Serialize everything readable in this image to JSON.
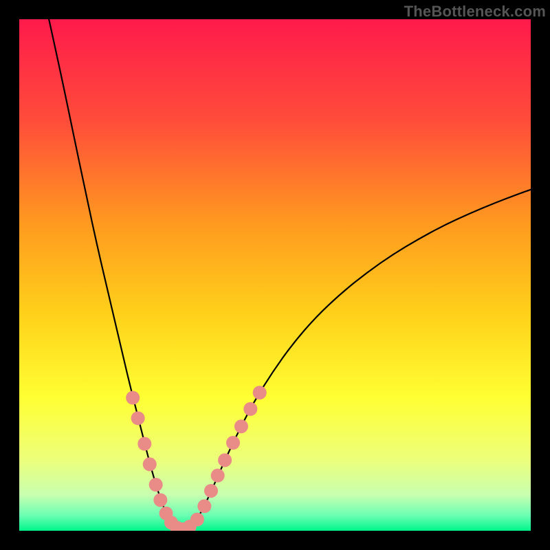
{
  "watermark": "TheBottleneck.com",
  "chart_data": {
    "type": "line",
    "title": "",
    "xlabel": "",
    "ylabel": "",
    "xlim": [
      0,
      100
    ],
    "ylim": [
      0,
      100
    ],
    "grid": false,
    "legend": false,
    "annotations": [],
    "background_gradient_stops": [
      {
        "offset": 0.0,
        "color": "#ff1a4b"
      },
      {
        "offset": 0.2,
        "color": "#ff4d3a"
      },
      {
        "offset": 0.4,
        "color": "#ff9a1f"
      },
      {
        "offset": 0.58,
        "color": "#ffd21a"
      },
      {
        "offset": 0.74,
        "color": "#ffff33"
      },
      {
        "offset": 0.86,
        "color": "#edff7a"
      },
      {
        "offset": 0.93,
        "color": "#c8ffb0"
      },
      {
        "offset": 0.97,
        "color": "#6bffb3"
      },
      {
        "offset": 1.0,
        "color": "#00f58a"
      }
    ],
    "series": [
      {
        "name": "bottleneck-curve",
        "points": [
          {
            "x": 5.8,
            "y": 100.0
          },
          {
            "x": 8.0,
            "y": 90.0
          },
          {
            "x": 10.5,
            "y": 78.0
          },
          {
            "x": 13.0,
            "y": 66.0
          },
          {
            "x": 15.5,
            "y": 54.5
          },
          {
            "x": 18.0,
            "y": 44.0
          },
          {
            "x": 20.2,
            "y": 34.5
          },
          {
            "x": 22.0,
            "y": 27.0
          },
          {
            "x": 23.8,
            "y": 20.0
          },
          {
            "x": 25.3,
            "y": 14.0
          },
          {
            "x": 26.8,
            "y": 8.7
          },
          {
            "x": 28.3,
            "y": 4.3
          },
          {
            "x": 29.7,
            "y": 1.4
          },
          {
            "x": 31.0,
            "y": 0.0
          },
          {
            "x": 32.5,
            "y": 0.0
          },
          {
            "x": 34.2,
            "y": 1.4
          },
          {
            "x": 36.0,
            "y": 4.4
          },
          {
            "x": 38.0,
            "y": 8.8
          },
          {
            "x": 40.3,
            "y": 14.0
          },
          {
            "x": 43.0,
            "y": 19.7
          },
          {
            "x": 46.0,
            "y": 25.4
          },
          {
            "x": 49.5,
            "y": 31.0
          },
          {
            "x": 53.5,
            "y": 36.6
          },
          {
            "x": 58.0,
            "y": 41.8
          },
          {
            "x": 63.0,
            "y": 46.5
          },
          {
            "x": 68.0,
            "y": 50.5
          },
          {
            "x": 73.0,
            "y": 54.0
          },
          {
            "x": 78.0,
            "y": 57.0
          },
          {
            "x": 83.0,
            "y": 59.7
          },
          {
            "x": 88.0,
            "y": 62.0
          },
          {
            "x": 93.0,
            "y": 64.1
          },
          {
            "x": 98.0,
            "y": 66.0
          },
          {
            "x": 100.0,
            "y": 66.7
          }
        ]
      }
    ],
    "markers": {
      "name": "highlighted-dots",
      "color": "#e98b87",
      "radius_px": 10,
      "points": [
        {
          "x": 22.2,
          "y": 26.0
        },
        {
          "x": 23.2,
          "y": 22.0
        },
        {
          "x": 24.5,
          "y": 17.0
        },
        {
          "x": 25.5,
          "y": 13.0
        },
        {
          "x": 26.7,
          "y": 9.0
        },
        {
          "x": 27.6,
          "y": 6.0
        },
        {
          "x": 28.7,
          "y": 3.4
        },
        {
          "x": 29.7,
          "y": 1.6
        },
        {
          "x": 30.8,
          "y": 0.6
        },
        {
          "x": 32.0,
          "y": 0.3
        },
        {
          "x": 33.3,
          "y": 0.8
        },
        {
          "x": 34.8,
          "y": 2.2
        },
        {
          "x": 36.2,
          "y": 4.8
        },
        {
          "x": 37.5,
          "y": 7.8
        },
        {
          "x": 38.8,
          "y": 10.8
        },
        {
          "x": 40.2,
          "y": 13.8
        },
        {
          "x": 41.8,
          "y": 17.2
        },
        {
          "x": 43.4,
          "y": 20.4
        },
        {
          "x": 45.2,
          "y": 23.8
        },
        {
          "x": 47.0,
          "y": 27.0
        }
      ]
    }
  }
}
